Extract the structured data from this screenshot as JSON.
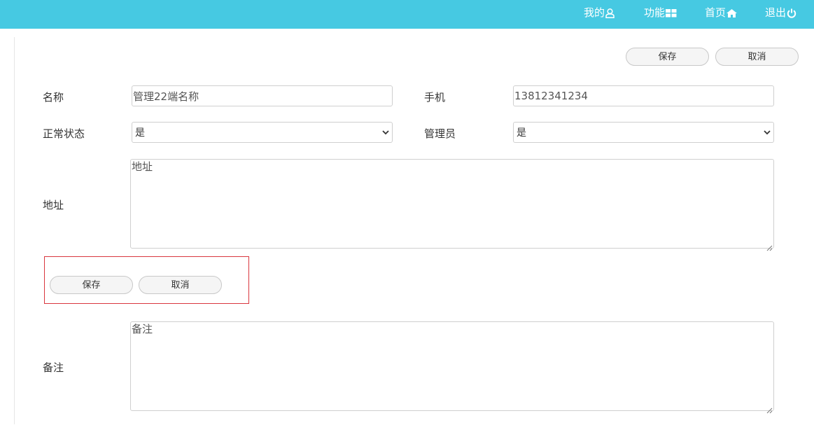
{
  "nav": {
    "mine": "我的",
    "features": "功能",
    "home": "首页",
    "logout": "退出"
  },
  "toolbar_top": {
    "save_label": "保存",
    "cancel_label": "取消"
  },
  "form": {
    "name_label": "名称",
    "name_value": "管理22端名称",
    "phone_label": "手机",
    "phone_value": "13812341234",
    "status_label": "正常状态",
    "status_value": "是",
    "admin_label": "管理员",
    "admin_value": "是",
    "address_label": "地址",
    "address_value": "地址",
    "remark_label": "备注",
    "remark_value": "备注"
  },
  "toolbar_middle": {
    "save_label": "保存",
    "cancel_label": "取消"
  },
  "colors": {
    "topbar": "#46c9e2",
    "highlight_border": "#d9363e"
  }
}
